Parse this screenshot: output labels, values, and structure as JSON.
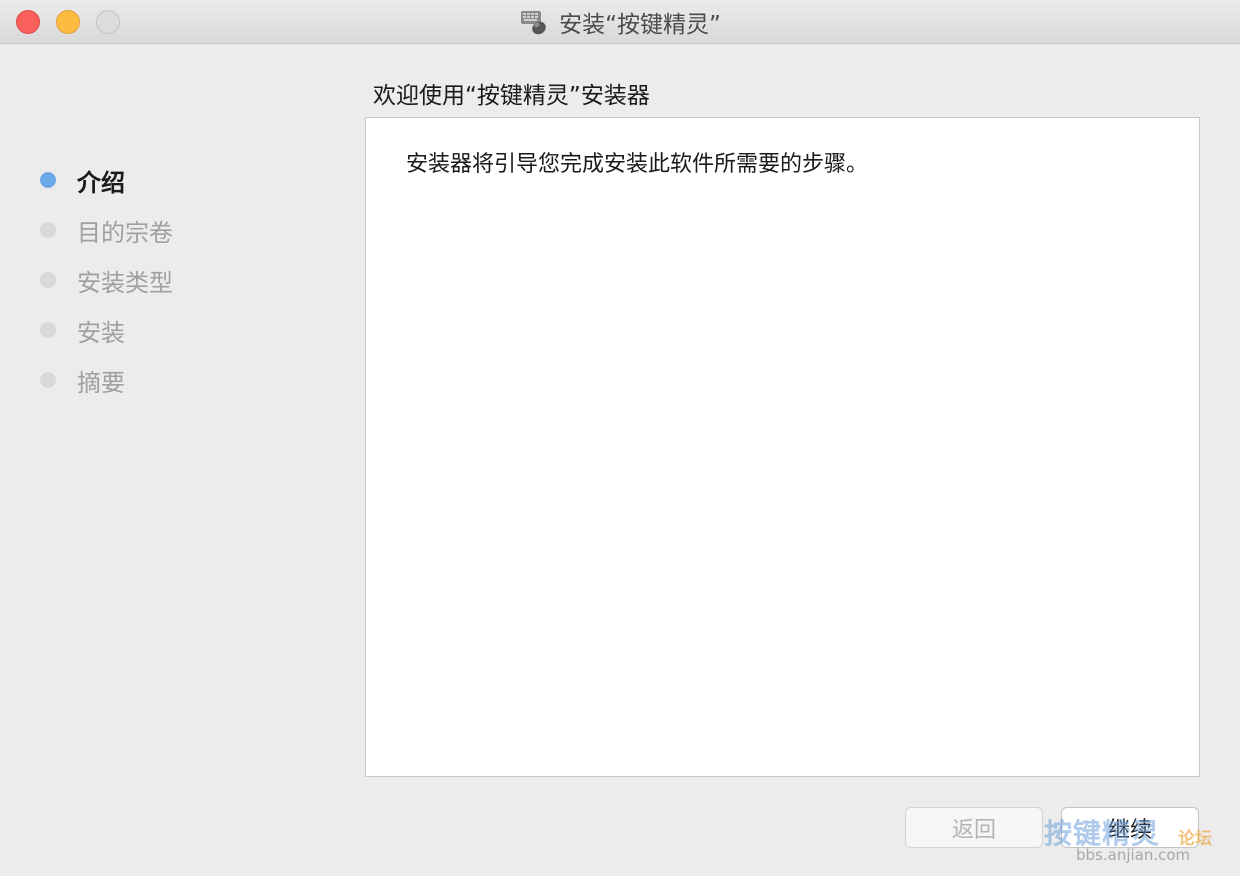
{
  "window": {
    "title": "安装“按键精灵”",
    "icon": "keyboard-mouse-app-icon"
  },
  "sidebar": {
    "steps": [
      {
        "label": "介绍",
        "active": true
      },
      {
        "label": "目的宗卷",
        "active": false
      },
      {
        "label": "安装类型",
        "active": false
      },
      {
        "label": "安装",
        "active": false
      },
      {
        "label": "摘要",
        "active": false
      }
    ]
  },
  "main": {
    "heading": "欢迎使用“按键精灵”安装器",
    "body_text": "安装器将引导您完成安装此软件所需要的步骤。"
  },
  "buttons": {
    "back_label": "返回",
    "continue_label": "继续"
  },
  "watermark": {
    "brand": "按键精灵",
    "forum": "论坛",
    "url": "bbs.anjian.com"
  },
  "colors": {
    "active_step": "#6aa9e9",
    "inactive_step": "#d9d9d9",
    "close": "#fc605c",
    "minimize": "#fdbc40",
    "zoom_disabled": "#dcdcdc"
  }
}
